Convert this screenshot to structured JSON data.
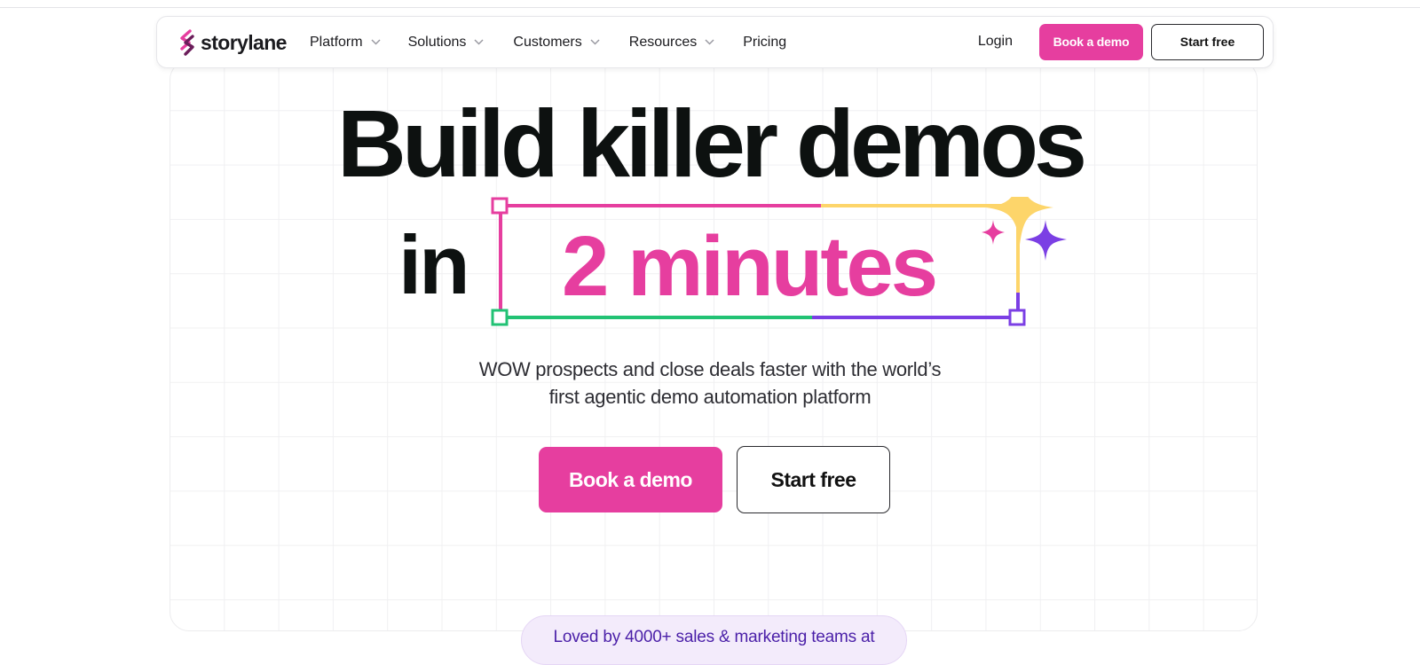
{
  "brand": {
    "name": "storylane",
    "accent": "#e63e9f",
    "dark": "#0d1110",
    "green": "#22c274",
    "purple": "#7b3fe4",
    "yellow": "#fdd56a"
  },
  "nav": {
    "items": [
      {
        "label": "Platform",
        "has_dropdown": true
      },
      {
        "label": "Solutions",
        "has_dropdown": true
      },
      {
        "label": "Customers",
        "has_dropdown": true
      },
      {
        "label": "Resources",
        "has_dropdown": true
      },
      {
        "label": "Pricing",
        "has_dropdown": false
      }
    ],
    "login_label": "Login",
    "book_demo_label": "Book a demo",
    "start_free_label": "Start free"
  },
  "hero": {
    "headline_line1": "Build killer demos",
    "headline_in": "in",
    "headline_highlight": "2 minutes",
    "subtitle_line1": "WOW prospects and close deals faster with the world’s",
    "subtitle_line2": "first agentic demo automation platform",
    "cta_primary": "Book a demo",
    "cta_secondary": "Start free"
  },
  "social_proof": {
    "loved_text": "Loved by 4000+ sales & marketing teams at"
  }
}
